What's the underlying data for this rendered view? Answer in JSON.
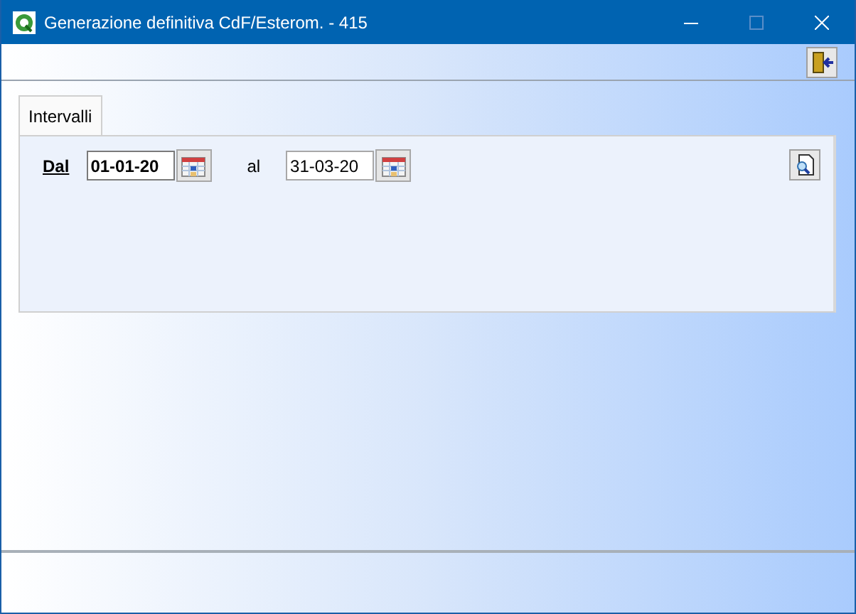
{
  "window": {
    "title": "Generazione definitiva CdF/Esterom. - 415"
  },
  "tabs": [
    {
      "label": "Intervalli",
      "selected": true
    }
  ],
  "range": {
    "from_label": "Dal",
    "to_label": "al",
    "fields": [
      {
        "value": "01-01-20",
        "focused": true
      },
      {
        "value": "31-03-20",
        "focused": false
      }
    ]
  }
}
